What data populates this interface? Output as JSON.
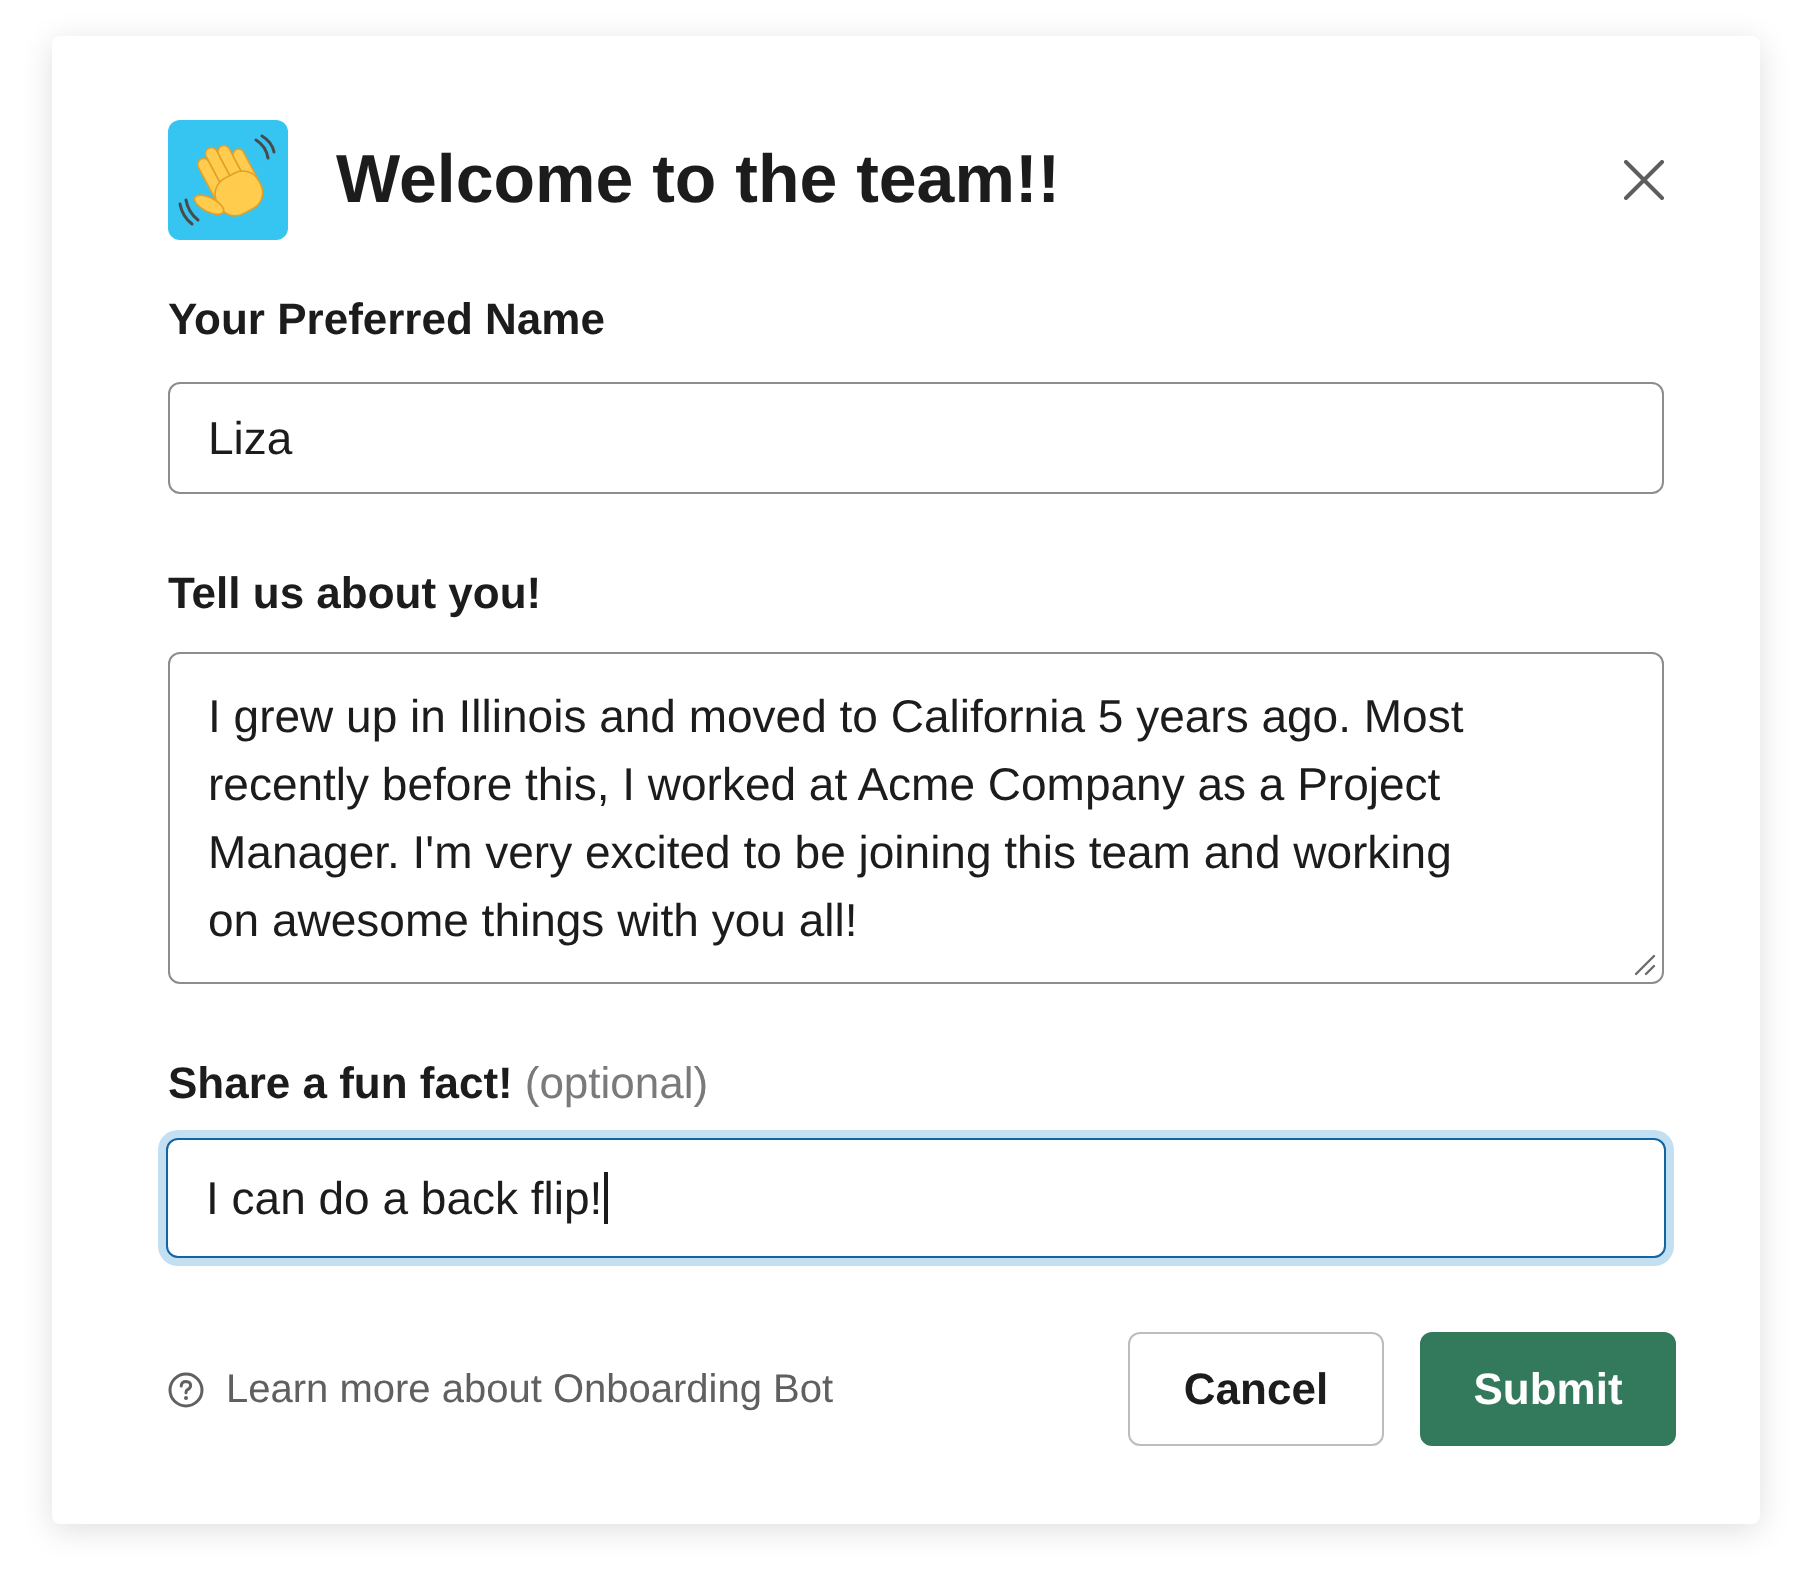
{
  "dialog": {
    "title": "Welcome to the team!!"
  },
  "fields": [
    {
      "kind": "input",
      "label": "Your Preferred Name",
      "value": "Liza",
      "focused": false
    },
    {
      "kind": "textarea",
      "label": "Tell us about you!",
      "value": "I grew up in Illinois and moved to California 5 years ago. Most recently before this, I worked at Acme Company as a Project Manager. I'm very excited to be joining this team and working on awesome things with you all!",
      "focused": false
    },
    {
      "kind": "input",
      "label": "Share a fun fact!",
      "note": "(optional)",
      "value": "I can do a back flip!",
      "focused": true
    }
  ],
  "footer": {
    "help_link": "Learn more about Onboarding Bot",
    "buttons": [
      {
        "label": "Cancel",
        "kind": "secondary"
      },
      {
        "label": "Submit",
        "kind": "primary"
      }
    ]
  }
}
